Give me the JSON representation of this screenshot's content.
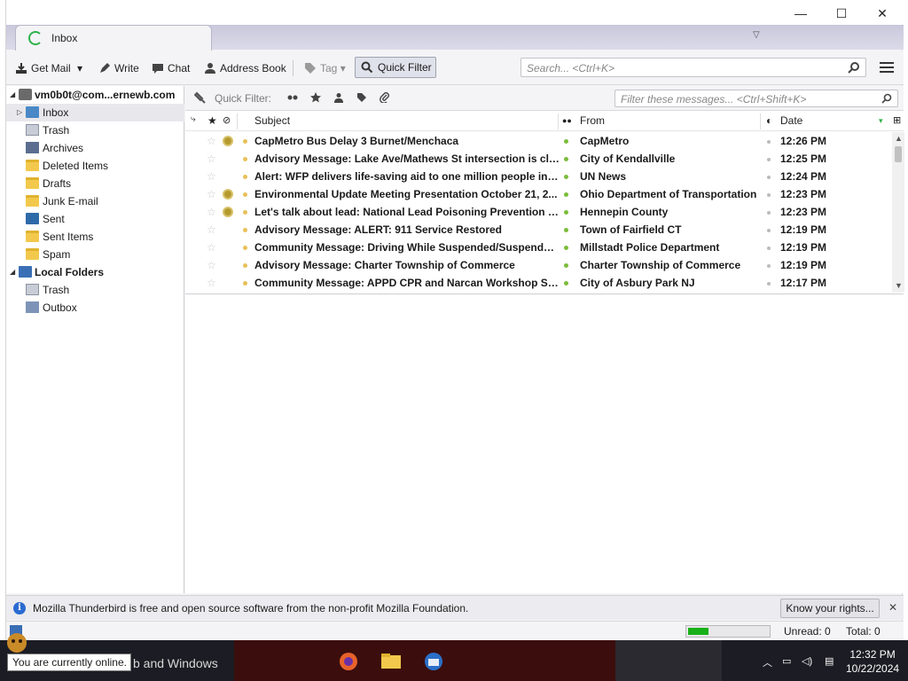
{
  "window": {
    "tab_label": "Inbox",
    "controls": {
      "minimize": "—",
      "maximize": "☐",
      "close": "✕"
    }
  },
  "toolbar": {
    "get_mail": "Get Mail",
    "write": "Write",
    "chat": "Chat",
    "address_book": "Address Book",
    "tag": "Tag",
    "quick_filter": "Quick Filter",
    "search_placeholder": "Search... <Ctrl+K>"
  },
  "folders": {
    "account": "vm0b0t@com...ernewb.com",
    "account_items": [
      "Inbox",
      "Trash",
      "Archives",
      "Deleted Items",
      "Drafts",
      "Junk E-mail",
      "Sent",
      "Sent Items",
      "Spam"
    ],
    "local": "Local Folders",
    "local_items": [
      "Trash",
      "Outbox"
    ]
  },
  "quick_filter_bar": {
    "label": "Quick Filter:",
    "filter_placeholder": "Filter these messages... <Ctrl+Shift+K>"
  },
  "columns": {
    "subject": "Subject",
    "from": "From",
    "date": "Date"
  },
  "messages": [
    {
      "subject": "CapMetro Bus Delay 3 Burnet/Menchaca",
      "from": "CapMetro",
      "date": "12:26 PM",
      "attachment": true
    },
    {
      "subject": "Advisory Message: Lake Ave/Mathews St intersection is clos...",
      "from": "City of Kendallville",
      "date": "12:25 PM",
      "attachment": false
    },
    {
      "subject": "Alert: WFP delivers life-saving aid to one million people in B...",
      "from": "UN News",
      "date": "12:24 PM",
      "attachment": false
    },
    {
      "subject": "Environmental Update Meeting Presentation October 21, 2...",
      "from": "Ohio Department of Transportation",
      "date": "12:23 PM",
      "attachment": true
    },
    {
      "subject": "Let's talk about lead: National Lead Poisoning Prevention W...",
      "from": "Hennepin County",
      "date": "12:23 PM",
      "attachment": true
    },
    {
      "subject": "Advisory Message: ALERT: 911 Service Restored",
      "from": "Town of Fairfield CT",
      "date": "12:19 PM",
      "attachment": false
    },
    {
      "subject": "Community Message: Driving While Suspended/Suspended ...",
      "from": "Millstadt Police Department",
      "date": "12:19 PM",
      "attachment": false
    },
    {
      "subject": "Advisory Message: Charter Township of Commerce",
      "from": "Charter Township of Commerce",
      "date": "12:19 PM",
      "attachment": false
    },
    {
      "subject": "Community Message: APPD CPR and Narcan Workshop Satu...",
      "from": "City of Asbury Park NJ",
      "date": "12:17 PM",
      "attachment": false
    }
  ],
  "notification": {
    "message": "Mozilla Thunderbird is free and open source software from the non-profit Mozilla Foundation.",
    "button": "Know your rights...",
    "close": "✕"
  },
  "status": {
    "unread": "Unread: 0",
    "total": "Total: 0",
    "progress_fraction": 0.25,
    "tooltip": "You are currently online."
  },
  "taskbar": {
    "search_text": "b and Windows",
    "time": "12:32 PM",
    "date": "10/22/2024"
  },
  "colors": {
    "accent_green": "#2eb14a",
    "unread_dot": "#7bbd3a",
    "progress": "#18b018"
  }
}
